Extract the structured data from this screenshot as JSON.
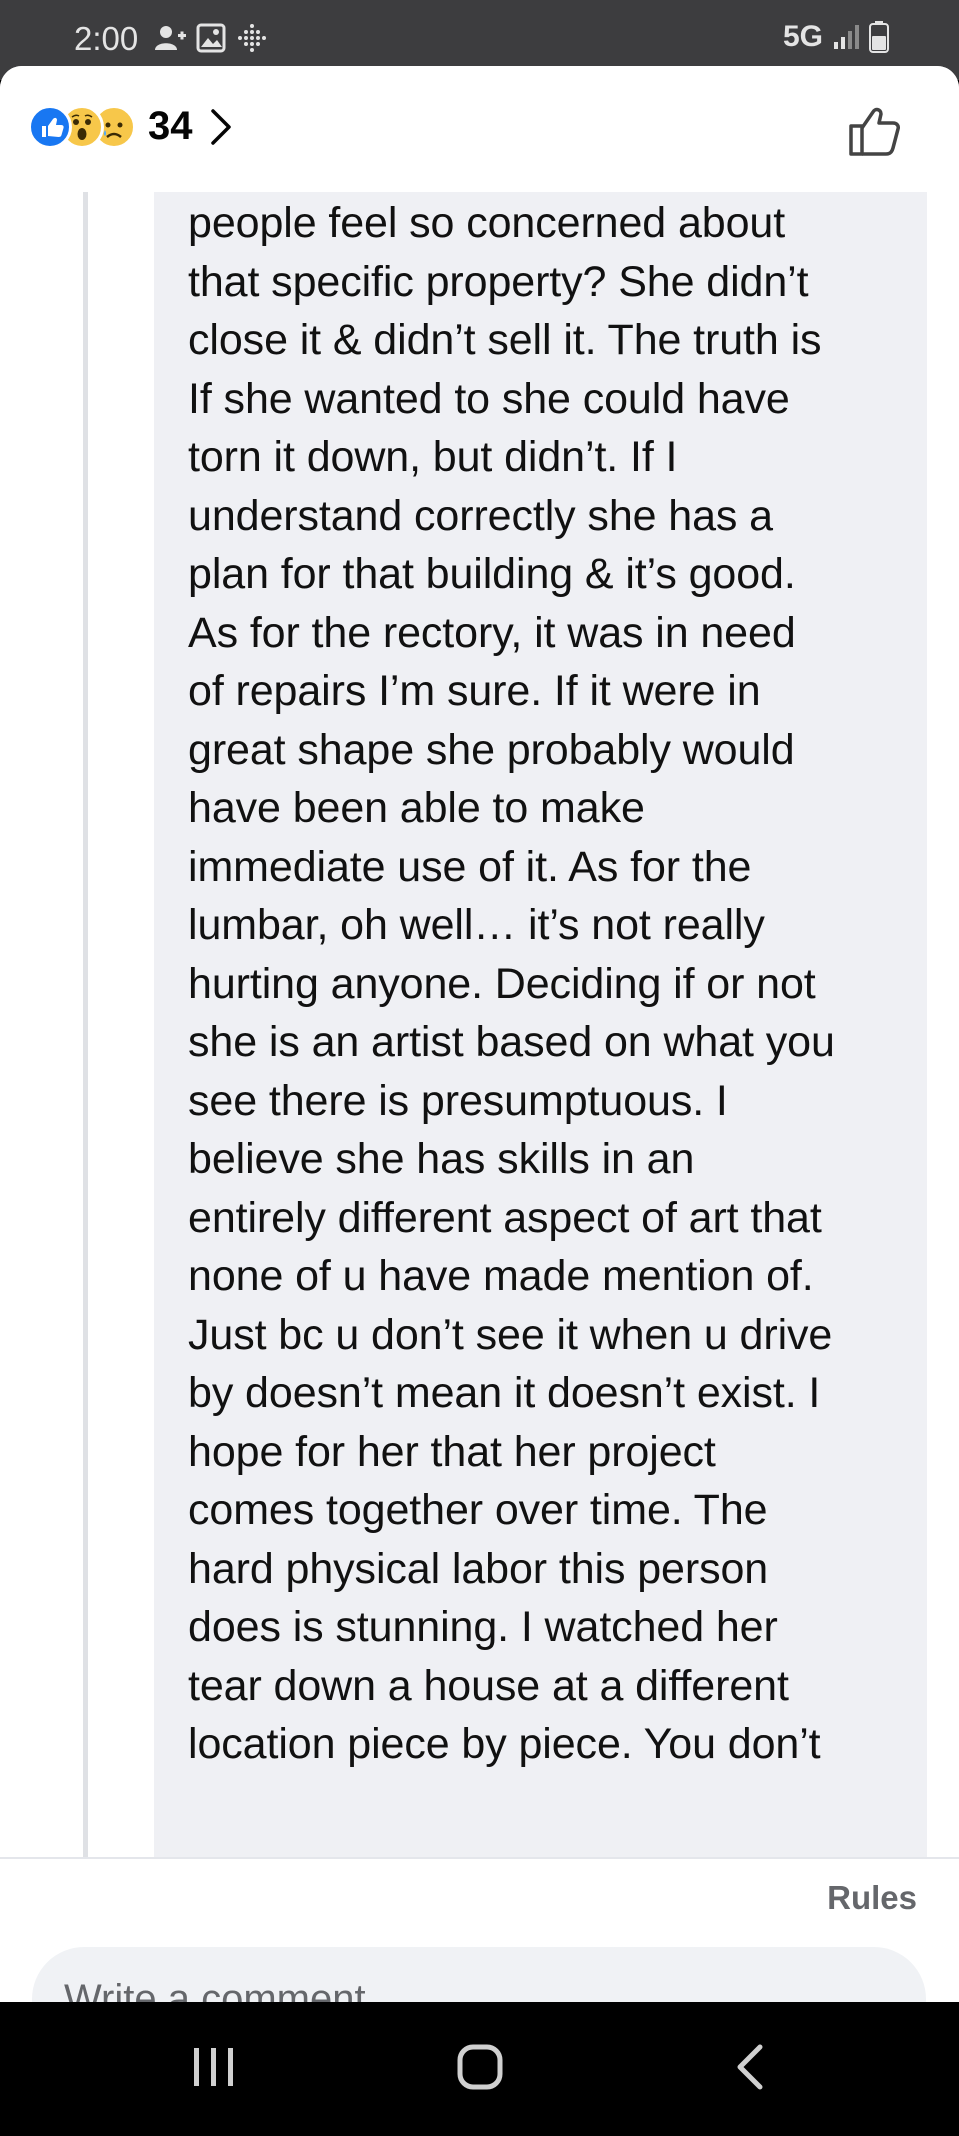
{
  "status_bar": {
    "time": "2:00",
    "network": "5G",
    "icons": [
      "person-add-icon",
      "image-icon",
      "dots-grid-icon",
      "signal-icon",
      "battery-icon"
    ]
  },
  "header": {
    "reaction_icons": [
      "like-reaction-icon",
      "wow-reaction-icon",
      "sad-reaction-icon"
    ],
    "reaction_count": "34",
    "like_color": "#1877f2"
  },
  "comment": {
    "lines": [
      "people feel so concerned about",
      "that specific property?  She didn’t",
      "close it & didn’t sell it.  The truth is",
      "If she wanted to she could have",
      "torn it down, but didn’t.  If I",
      "understand correctly she has a",
      "plan for that building & it’s good.",
      "As for the rectory, it was in need",
      "of repairs I’m sure.  If it were in",
      "great shape she probably would",
      "have been able to make",
      "immediate use of it.  As for the",
      "lumbar, oh well… it’s not really",
      "hurting anyone.  Deciding if or not",
      "she is an artist based on what you",
      "see there is presumptuous.  I",
      "believe she has skills in an",
      "entirely different aspect of art that",
      "none of u have made mention of.",
      "Just bc u don’t see it when u drive",
      "by doesn’t mean it doesn’t exist.  I",
      "hope for her that her project",
      "comes together over time.  The",
      "hard physical labor this person",
      "does is stunning.  I watched her",
      "tear down a house at a different",
      "location piece by piece.  You don’t"
    ]
  },
  "footer": {
    "rules_label": "Rules",
    "comment_placeholder": "Write a comment…"
  },
  "nav_bar": {
    "buttons": [
      "recent-apps-icon",
      "home-icon",
      "back-icon"
    ]
  }
}
